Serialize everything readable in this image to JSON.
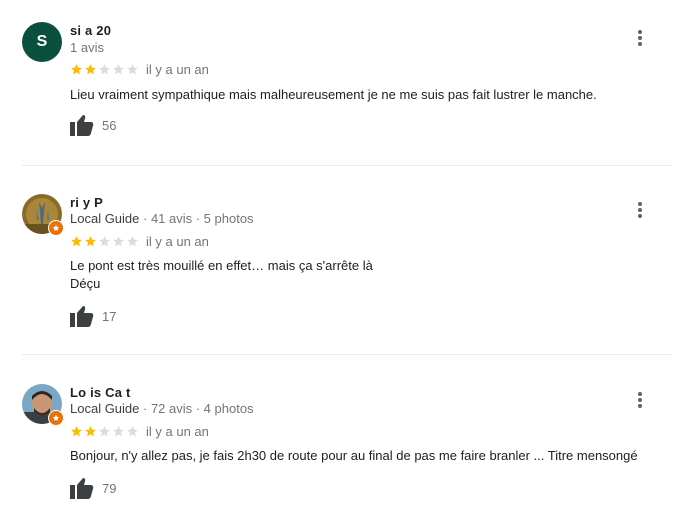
{
  "reviews": [
    {
      "avatar_letter": "S",
      "name": "si    a 20",
      "meta": "1 avis",
      "rating": 2,
      "date": "il y a un an",
      "text": "Lieu vraiment sympathique mais malheureusement je ne me suis pas fait lustrer le manche.",
      "likes": "56"
    },
    {
      "name": "ri   y P",
      "local_guide": "Local Guide",
      "meta": " · 41 avis · 5 photos",
      "rating": 2,
      "date": "il y a un an",
      "text_line1": "Le pont est très mouillé en effet… mais ça s'arrête là",
      "text_line2": "Déçu",
      "likes": "17"
    },
    {
      "name": "Lo  is Ca     t",
      "local_guide": "Local Guide",
      "meta": " · 72 avis · 4 photos",
      "rating": 2,
      "date": "il y a un an",
      "text": "Bonjour, n'y allez pas, je fais 2h30 de route pour au final de pas me faire branler ... Titre mensongé",
      "likes": "79"
    }
  ],
  "colors": {
    "star_filled": "#fbbc04",
    "star_empty": "#dadce0",
    "avatar_bg": "#0b4f3f",
    "local_guide_badge": "#e8710a"
  }
}
